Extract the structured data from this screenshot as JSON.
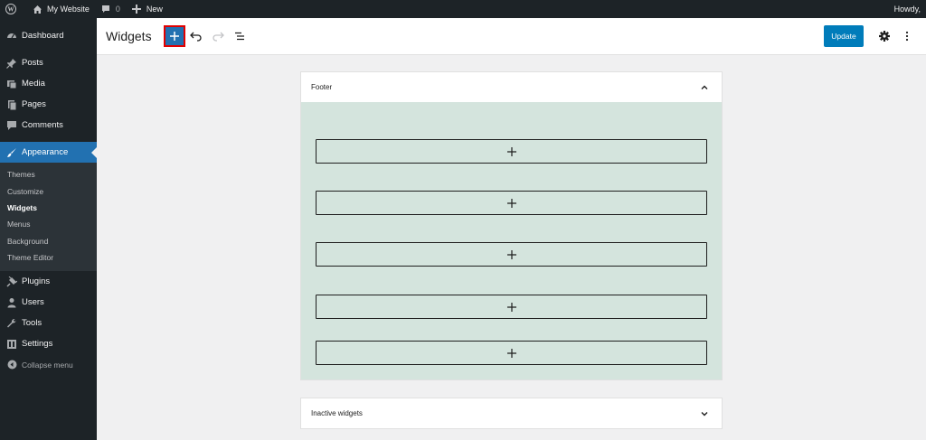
{
  "adminbar": {
    "site_name": "My Website",
    "comments_count": "0",
    "new_label": "New",
    "howdy": "Howdy,"
  },
  "sidebar": {
    "items": [
      {
        "label": "Dashboard",
        "icon": "dashboard-icon"
      },
      {
        "label": "Posts",
        "icon": "pin-icon"
      },
      {
        "label": "Media",
        "icon": "media-icon"
      },
      {
        "label": "Pages",
        "icon": "pages-icon"
      },
      {
        "label": "Comments",
        "icon": "comment-icon"
      },
      {
        "label": "Appearance",
        "icon": "brush-icon"
      },
      {
        "label": "Plugins",
        "icon": "plug-icon"
      },
      {
        "label": "Users",
        "icon": "user-icon"
      },
      {
        "label": "Tools",
        "icon": "wrench-icon"
      },
      {
        "label": "Settings",
        "icon": "settings-icon"
      }
    ],
    "submenu": [
      "Themes",
      "Customize",
      "Widgets",
      "Menus",
      "Background",
      "Theme Editor"
    ],
    "collapse_label": "Collapse menu"
  },
  "header": {
    "title": "Widgets",
    "update_label": "Update"
  },
  "areas": {
    "footer_title": "Footer",
    "inactive_title": "Inactive widgets"
  },
  "colors": {
    "admin_dark": "#1d2327",
    "accent": "#2271b1",
    "footer_bg": "#d4e4dd",
    "highlight": "#e10000"
  }
}
